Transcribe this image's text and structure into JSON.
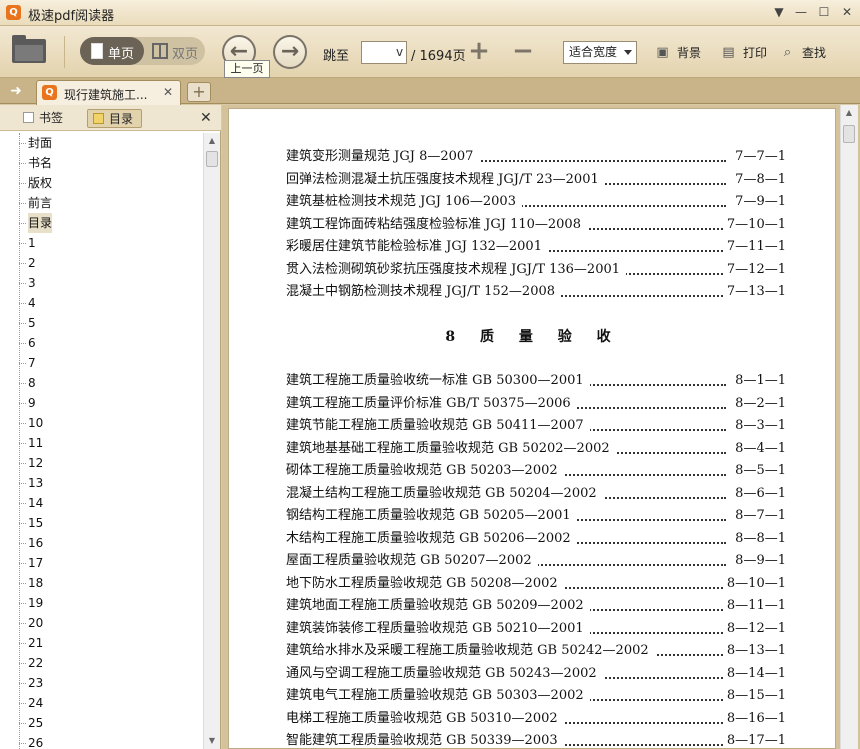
{
  "app": {
    "title": "极速pdf阅读器",
    "logo_glyph": "Q",
    "controls": {
      "menu": "▼",
      "minimize": "—",
      "maximize": "☐",
      "close": "✕"
    }
  },
  "toolbar": {
    "single_page_label": "单页",
    "double_page_label": "双页",
    "prev_glyph": "←",
    "next_glyph": "→",
    "prev_tooltip": "上一页",
    "jump_label": "跳至",
    "page_input_value": "v",
    "page_total": "/ 1694页",
    "zoom_in_glyph": "+",
    "zoom_out_glyph": "−",
    "fit_mode": "适合宽度",
    "background_label": "背景",
    "print_label": "打印",
    "find_label": "查找"
  },
  "tabs": {
    "doc_tab_label": "现行建筑施工...",
    "doc_tab_close": "✕",
    "new_tab_glyph": "+",
    "sidebar_toggle_glyph": "➜"
  },
  "sidebar": {
    "bookmarks_label": "书签",
    "toc_label": "目录",
    "close_glyph": "✕",
    "items": [
      "封面",
      "书名",
      "版权",
      "前言",
      "目录",
      "1",
      "2",
      "3",
      "4",
      "5",
      "6",
      "7",
      "8",
      "9",
      "10",
      "11",
      "12",
      "13",
      "14",
      "15",
      "16",
      "17",
      "18",
      "19",
      "20",
      "21",
      "22",
      "23",
      "24",
      "25",
      "26"
    ],
    "selected_index": 4
  },
  "document": {
    "lines_a": [
      {
        "title": "建筑变形测量规范 JGJ 8—2007",
        "page": "7—7—1"
      },
      {
        "title": "回弹法检测混凝土抗压强度技术规程 JGJ/T 23—2001",
        "page": "7—8—1"
      },
      {
        "title": "建筑基桩检测技术规范 JGJ 106—2003",
        "page": "7—9—1"
      },
      {
        "title": "建筑工程饰面砖粘结强度检验标准 JGJ 110—2008",
        "page": "7—10—1"
      },
      {
        "title": "彩暖居住建筑节能检验标准 JGJ 132—2001",
        "page": "7—11—1"
      },
      {
        "title": "贯入法检测砌筑砂浆抗压强度技术规程 JGJ/T 136—2001",
        "page": "7—12—1"
      },
      {
        "title": "混凝土中钢筋检测技术规程 JGJ/T 152—2008",
        "page": "7—13—1"
      }
    ],
    "section_heading": "8 质 量 验 收",
    "lines_b": [
      {
        "title": "建筑工程施工质量验收统一标准 GB 50300—2001",
        "page": "8—1—1"
      },
      {
        "title": "建筑工程施工质量评价标准 GB/T 50375—2006",
        "page": "8—2—1"
      },
      {
        "title": "建筑节能工程施工质量验收规范 GB 50411—2007",
        "page": "8—3—1"
      },
      {
        "title": "建筑地基基础工程施工质量验收规范 GB 50202—2002",
        "page": "8—4—1"
      },
      {
        "title": "砌体工程施工质量验收规范 GB 50203—2002",
        "page": "8—5—1"
      },
      {
        "title": "混凝土结构工程施工质量验收规范 GB 50204—2002",
        "page": "8—6—1"
      },
      {
        "title": "钢结构工程施工质量验收规范 GB 50205—2001",
        "page": "8—7—1"
      },
      {
        "title": "木结构工程施工质量验收规范 GB 50206—2002",
        "page": "8—8—1"
      },
      {
        "title": "屋面工程质量验收规范 GB 50207—2002",
        "page": "8—9—1"
      },
      {
        "title": "地下防水工程质量验收规范 GB 50208—2002",
        "page": "8—10—1"
      },
      {
        "title": "建筑地面工程施工质量验收规范 GB 50209—2002",
        "page": "8—11—1"
      },
      {
        "title": "建筑装饰装修工程质量验收规范 GB 50210—2001",
        "page": "8—12—1"
      },
      {
        "title": "建筑给水排水及采暖工程施工质量验收规范 GB 50242—2002",
        "page": "8—13—1"
      },
      {
        "title": "通风与空调工程施工质量验收规范 GB 50243—2002",
        "page": "8—14—1"
      },
      {
        "title": "建筑电气工程施工质量验收规范 GB 50303—2002",
        "page": "8—15—1"
      },
      {
        "title": "电梯工程施工质量验收规范 GB 50310—2002",
        "page": "8—16—1"
      },
      {
        "title": "智能建筑工程质量验收规范 GB 50339—2003",
        "page": "8—17—1"
      }
    ]
  },
  "colors": {
    "accent": "#e8741e",
    "chrome": "#e3d3ae",
    "page_bg": "#ffffff"
  }
}
